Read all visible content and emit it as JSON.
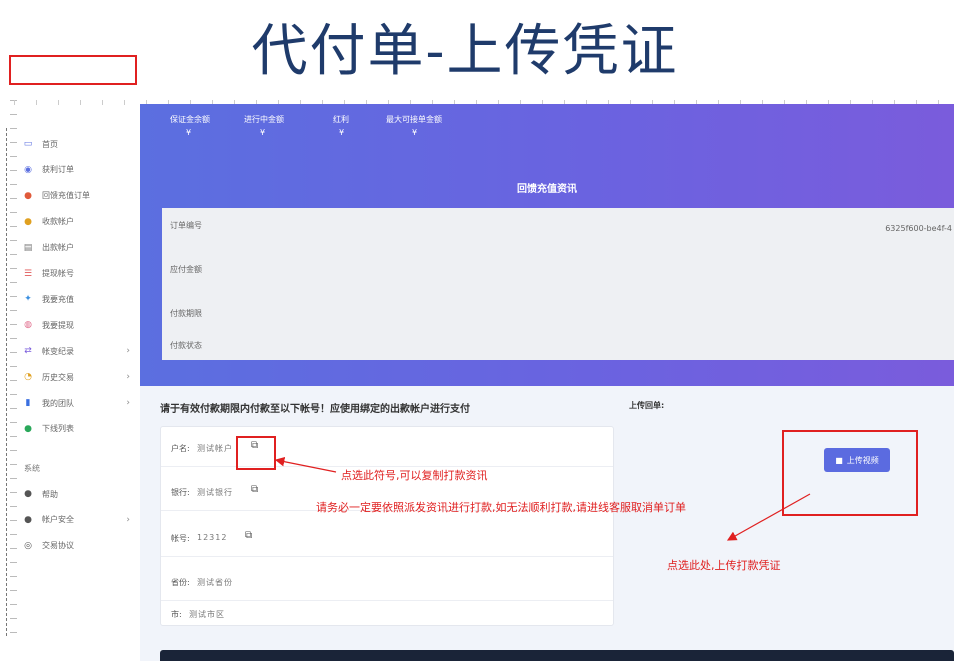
{
  "slide_title": "代付单-上传凭证",
  "sidebar": {
    "items": [
      {
        "label": "首页",
        "icon": "monitor-icon",
        "color": "#5b6fe0"
      },
      {
        "label": "获利订单",
        "icon": "orders-icon",
        "color": "#5b6fe0"
      },
      {
        "label": "回馈充值订单",
        "icon": "location-pin-icon",
        "color": "#e05a3a"
      },
      {
        "label": "收款帐户",
        "icon": "user-icon",
        "color": "#e0a020"
      },
      {
        "label": "出款帐户",
        "icon": "accounts-icon",
        "color": "#777777"
      },
      {
        "label": "提现帐号",
        "icon": "list-icon",
        "color": "#e05a5a"
      },
      {
        "label": "我要充值",
        "icon": "deposit-icon",
        "color": "#3a8fe0"
      },
      {
        "label": "我要提现",
        "icon": "withdraw-icon",
        "color": "#e06a8a"
      },
      {
        "label": "帐变纪录",
        "icon": "transfer-icon",
        "color": "#7a5cdc",
        "chevron": true
      },
      {
        "label": "历史交易",
        "icon": "history-icon",
        "color": "#e0a020",
        "chevron": true
      },
      {
        "label": "我的团队",
        "icon": "bar-chart-icon",
        "color": "#3a6fe0",
        "chevron": true
      },
      {
        "label": "下线列表",
        "icon": "team-icon",
        "color": "#2aa85a"
      }
    ],
    "section_label": "系统",
    "system_items": [
      {
        "label": "帮助",
        "icon": "help-icon",
        "color": "#555555"
      },
      {
        "label": "帐户安全",
        "icon": "security-user-icon",
        "color": "#555555",
        "chevron": true
      },
      {
        "label": "交易协议",
        "icon": "eye-icon",
        "color": "#555555"
      }
    ]
  },
  "banner": {
    "stats": [
      {
        "label": "保证金余额",
        "value": "¥"
      },
      {
        "label": "进行中金额",
        "value": "¥"
      },
      {
        "label": "红利",
        "value": "¥"
      },
      {
        "label": "最大可接单金额",
        "value": "¥"
      }
    ],
    "title": "回馈充值资讯"
  },
  "info": {
    "order_no_label": "订单编号",
    "order_no_value": "6325f600-be4f-4",
    "amount_label": "应付金额",
    "deadline_label": "付款期限",
    "status_label": "付款状态"
  },
  "payment": {
    "title": "请于有效付款期限内付款至以下帐号！应使用绑定的出款帐户进行支付",
    "rows": [
      {
        "label": "户名:",
        "value": "测试帐户"
      },
      {
        "label": "银行:",
        "value": "测试银行"
      },
      {
        "label": "帐号:",
        "value": "12312"
      },
      {
        "label": "省份:",
        "value": "测试省份"
      },
      {
        "label": "市:",
        "value": "测试市区"
      }
    ]
  },
  "upload": {
    "title": "上传回单:",
    "button_label": "上传视频"
  },
  "notes": {
    "copy_hint": "点选此符号,可以复制打款资讯",
    "warning": "请务必一定要依照派发资讯进行打款,如无法顺利打款,请进线客服取消单订单",
    "upload_hint": "点选此处,上传打款凭证"
  },
  "colors": {
    "accent": "#5b6be0",
    "annotation": "#e02020",
    "title": "#1f3b6b"
  }
}
